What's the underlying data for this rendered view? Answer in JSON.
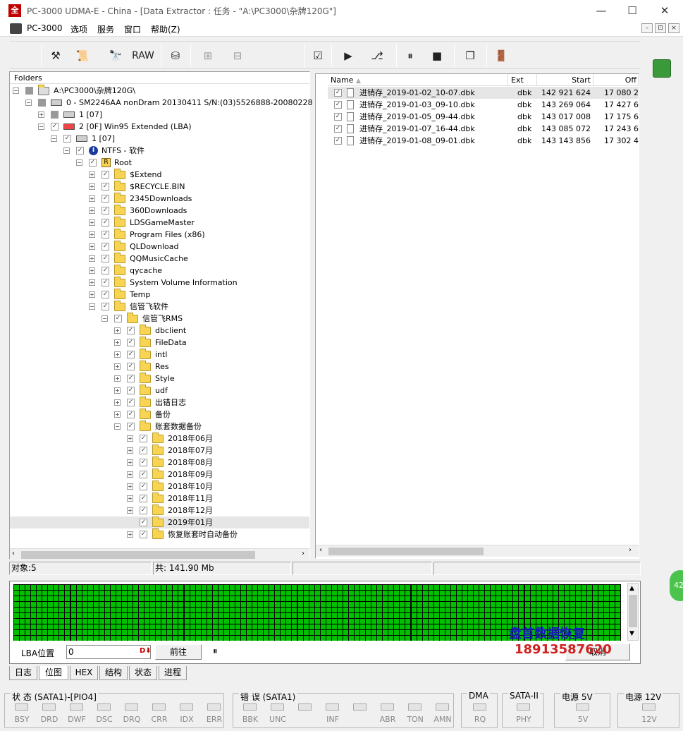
{
  "window": {
    "title": "PC-3000 UDMA-E - China - [Data Extractor : 任务 - \"A:\\PC3000\\杂牌120G\"]",
    "min": "—",
    "max": "☐",
    "close": "✕"
  },
  "menu": {
    "items": [
      "PC-3000",
      "选项",
      "服务",
      "窗口",
      "帮助(Z)"
    ],
    "mdi": [
      "–",
      "⊡",
      "×"
    ]
  },
  "toolbar": {
    "raw_label": "RAW"
  },
  "folders": {
    "header": "Folders",
    "rows": [
      "A:\\PC3000\\杂牌120G\\",
      "0 - SM2246AA nonDram 20130411 S/N:(03)5526888-20080228",
      "1 [07]",
      "2 [0F] Win95 Extended  (LBA)",
      "1 [07]",
      "NTFS - 软件",
      "Root",
      "$Extend",
      "$RECYCLE.BIN",
      "2345Downloads",
      "360Downloads",
      "LDSGameMaster",
      "Program Files (x86)",
      "QLDownload",
      "QQMusicCache",
      "qycache",
      "System Volume Information",
      "Temp",
      "信管飞软件",
      "信管飞RMS",
      "dbclient",
      "FileData",
      "intl",
      "Res",
      "Style",
      "udf",
      "出错日志",
      "备份",
      "账套数据备份",
      "2018年06月",
      "2018年07月",
      "2018年08月",
      "2018年09月",
      "2018年10月",
      "2018年11月",
      "2018年12月",
      "2019年01月",
      "恢复账套时自动备份"
    ],
    "root_badge": "R",
    "info_badge": "i"
  },
  "files": {
    "columns": [
      "Name",
      "Ext",
      "Start",
      "Off"
    ],
    "rows": [
      {
        "name": "进销存_2019-01-02_10-07.dbk",
        "ext": "dbk",
        "start": "142 921 624",
        "off": "17 080 2"
      },
      {
        "name": "进销存_2019-01-03_09-10.dbk",
        "ext": "dbk",
        "start": "143 269 064",
        "off": "17 427 6"
      },
      {
        "name": "进销存_2019-01-05_09-44.dbk",
        "ext": "dbk",
        "start": "143 017 008",
        "off": "17 175 6"
      },
      {
        "name": "进销存_2019-01-07_16-44.dbk",
        "ext": "dbk",
        "start": "143 085 072",
        "off": "17 243 6"
      },
      {
        "name": "进销存_2019-01-08_09-01.dbk",
        "ext": "dbk",
        "start": "143 143 856",
        "off": "17 302 4"
      }
    ]
  },
  "statusbar": {
    "objects": "对象:5",
    "total": "共: 141.90 Mb"
  },
  "lba": {
    "label": "LBA位置",
    "value": "0",
    "go_button": "前往",
    "pause": "⏸",
    "cancel_button": "取消"
  },
  "watermark": {
    "line1": "盘首数据恢复",
    "line2": "18913587620"
  },
  "tabs": [
    "日志",
    "位图",
    "HEX",
    "结构",
    "状态",
    "进程"
  ],
  "panels": {
    "status": {
      "title": "状 态 (SATA1)-[PIO4]",
      "leds": [
        "BSY",
        "DRD",
        "DWF",
        "DSC",
        "DRQ",
        "CRR",
        "IDX",
        "ERR"
      ]
    },
    "error": {
      "title": "错 误 (SATA1)",
      "leds": [
        "BBK",
        "UNC",
        "",
        "INF",
        "",
        "ABR",
        "TON",
        "AMN"
      ]
    },
    "dma": {
      "title": "DMA",
      "leds": [
        "RQ"
      ]
    },
    "sata": {
      "title": "SATA-II",
      "leds": [
        "PHY"
      ]
    },
    "p5": {
      "title": "电源 5V",
      "leds": [
        "5V"
      ]
    },
    "p12": {
      "title": "电源 12V",
      "leds": [
        "12V"
      ]
    }
  },
  "side_badge": "42",
  "colors": {
    "bitmap_cell": "#00c000",
    "accent_red": "#c00000"
  }
}
